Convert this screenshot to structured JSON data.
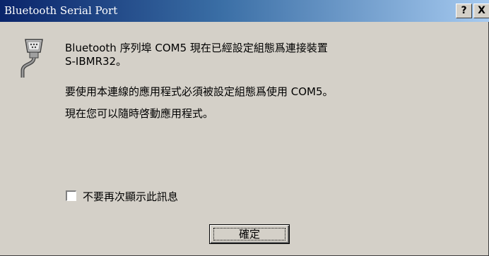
{
  "window": {
    "title": "Bluetooth Serial Port",
    "help_button": "?",
    "close_button": "X"
  },
  "icons": {
    "port": "serial-port-icon"
  },
  "message": {
    "line1": "Bluetooth 序列埠 COM5 現在已經設定組態爲連接裝置",
    "line1b": "S-IBMR32。",
    "line2": "要使用本連線的應用程式必須被設定組態爲使用 COM5。",
    "line3": "現在您可以隨時啓動應用程式。"
  },
  "checkbox": {
    "label": "不要再次顯示此訊息",
    "checked": false
  },
  "ok_button": {
    "label": "確定"
  },
  "colors": {
    "titlebar_start": "#0a246a",
    "titlebar_end": "#a6caf0",
    "face": "#d4d0c8"
  }
}
